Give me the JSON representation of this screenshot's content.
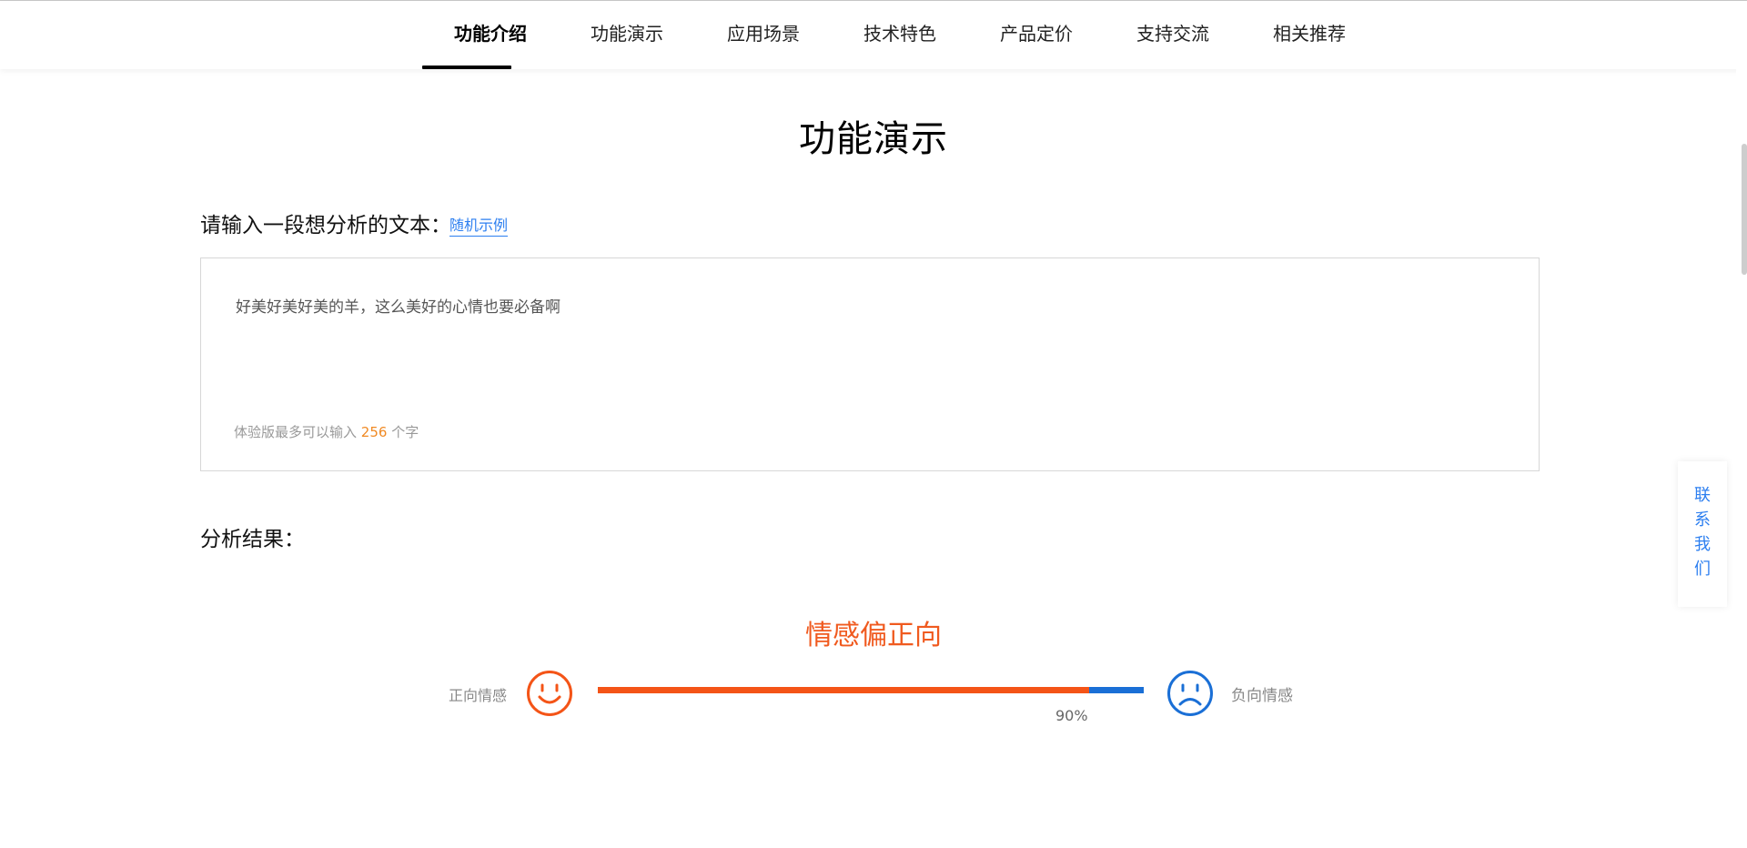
{
  "nav": {
    "items": [
      {
        "label": "功能介绍",
        "active": true
      },
      {
        "label": "功能演示",
        "active": false
      },
      {
        "label": "应用场景",
        "active": false
      },
      {
        "label": "技术特色",
        "active": false
      },
      {
        "label": "产品定价",
        "active": false
      },
      {
        "label": "支持交流",
        "active": false
      },
      {
        "label": "相关推荐",
        "active": false
      }
    ]
  },
  "section": {
    "title": "功能演示"
  },
  "input": {
    "label": "请输入一段想分析的文本：",
    "random_link": "随机示例",
    "text": "好美好美好美的羊，这么美好的心情也要必备啊",
    "limit_prefix": "体验版最多可以输入",
    "limit_number": "256",
    "limit_suffix": "个字"
  },
  "result": {
    "label": "分析结果：",
    "verdict": "情感偏正向",
    "positive_label": "正向情感",
    "negative_label": "负向情感",
    "positive_percent_text": "90%",
    "positive_fraction": 0.9,
    "positive_icon": "smile-face-icon",
    "negative_icon": "frown-face-icon"
  },
  "contact": {
    "chars": [
      "联",
      "系",
      "我",
      "们"
    ]
  },
  "colors": {
    "positive": "#f45417",
    "negative": "#1a6fd6",
    "link": "#2d7ff0",
    "limit_number": "#f08a24"
  }
}
